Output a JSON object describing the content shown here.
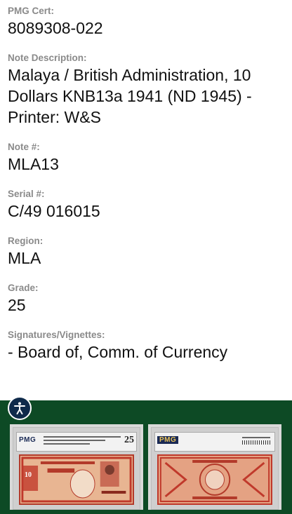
{
  "fields": [
    {
      "label": "PMG Cert:",
      "value": "8089308-022"
    },
    {
      "label": "Note Description:",
      "value": "Malaya / British Administration, 10 Dollars KNB13a 1941 (ND 1945) - Printer: W&S"
    },
    {
      "label": "Note #:",
      "value": "MLA13"
    },
    {
      "label": "Serial #:",
      "value": "C/49 016015"
    },
    {
      "label": "Region:",
      "value": "MLA"
    },
    {
      "label": "Grade:",
      "value": "25"
    },
    {
      "label": "Signatures/Vignettes:",
      "value": "- Board of, Comm. of Currency"
    }
  ],
  "images": {
    "front": {
      "brand": "PMG",
      "grade": "25",
      "denomination": "10"
    },
    "back": {
      "brand": "PMG"
    }
  },
  "colors": {
    "footer": "#0d4a25",
    "label": "#8a8a8a",
    "note_red": "#c0392b"
  },
  "icons": {
    "accessibility": "accessibility-icon"
  }
}
